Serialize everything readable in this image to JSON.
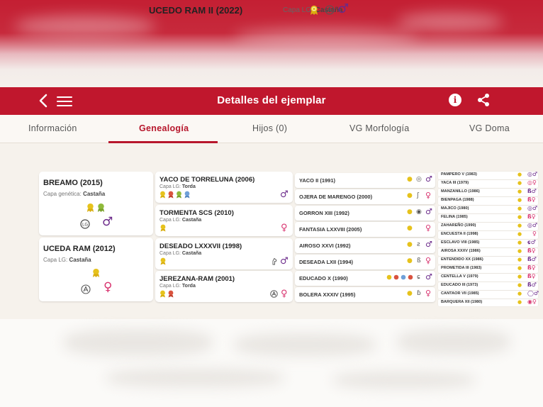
{
  "header": {
    "title": "Detalles del ejemplar",
    "back_icon": "chevron-left-icon",
    "menu_icon": "hamburger-icon",
    "info_icon": "info-icon",
    "share_icon": "share-icon",
    "bar_color": "#c0172d"
  },
  "tabs": [
    {
      "label": "Información"
    },
    {
      "label": "Genealogía",
      "active": true
    },
    {
      "label": "Hijos (0)"
    },
    {
      "label": "VG Morfología"
    },
    {
      "label": "VG Doma"
    }
  ],
  "subject": {
    "name": "UCEDO RAM II (2022)",
    "capa_label": "Capa LG:",
    "capa_value": "Castaña"
  },
  "parents": [
    {
      "name": "BREAMO (2015)",
      "capa_label": "Capa genética:",
      "capa_value": "Castaña",
      "sex": "male"
    },
    {
      "name": "UCEDA RAM (2012)",
      "capa_label": "Capa LG:",
      "capa_value": "Castaña",
      "sex": "female"
    }
  ],
  "grandparents": [
    {
      "name": "YACO DE TORRELUNA (2006)",
      "capa_label": "Capa LG:",
      "capa_value": "Torda",
      "sex": "male"
    },
    {
      "name": "TORMENTA SCS (2010)",
      "capa_label": "Capa LG:",
      "capa_value": "Castaña",
      "sex": "female"
    },
    {
      "name": "DESEADO LXXXVII (1998)",
      "capa_label": "Capa LG:",
      "capa_value": "Castaña",
      "sex": "male"
    },
    {
      "name": "JEREZANA-RAM (2001)",
      "capa_label": "Capa LG:",
      "capa_value": "Torda",
      "sex": "female"
    }
  ],
  "great_grandparents": [
    {
      "name": "YACO II (1991)",
      "sex": "male"
    },
    {
      "name": "OJERA DE MARENGO (2000)",
      "sex": "female"
    },
    {
      "name": "GORRON XIII (1992)",
      "sex": "male"
    },
    {
      "name": "FANTASIA LXXVIII (2005)",
      "sex": "female"
    },
    {
      "name": "AIROSO XXVI (1992)",
      "sex": "male"
    },
    {
      "name": "DESEADA LXII (1994)",
      "sex": "female"
    },
    {
      "name": "EDUCADO X (1990)",
      "sex": "male"
    },
    {
      "name": "BOLERA XXXIV (1995)",
      "sex": "female"
    }
  ],
  "great_great_grandparents": [
    {
      "name": "PAMPERO V (1983)",
      "sex": "male"
    },
    {
      "name": "YACA III (1979)",
      "sex": "female"
    },
    {
      "name": "MANZANILLO (1986)",
      "sex": "male"
    },
    {
      "name": "BIENPAGA (1988)",
      "sex": "female"
    },
    {
      "name": "MAJICO (1980)",
      "sex": "male"
    },
    {
      "name": "FELINA (1985)",
      "sex": "female"
    },
    {
      "name": "ZAHAREÑO (1990)",
      "sex": "male"
    },
    {
      "name": "ENCUESTA II (1998)",
      "sex": "female"
    },
    {
      "name": "ESCLAVO VIII (1985)",
      "sex": "male"
    },
    {
      "name": "AIROSA XXXV (1986)",
      "sex": "female"
    },
    {
      "name": "ENTENDIDO XX (1986)",
      "sex": "male"
    },
    {
      "name": "PROMETIDA III (1983)",
      "sex": "female"
    },
    {
      "name": "CENTELLA V (1979)",
      "sex": "female"
    },
    {
      "name": "EDUCADO III (1973)",
      "sex": "male"
    },
    {
      "name": "CANTAOR VII (1985)",
      "sex": "male"
    },
    {
      "name": "BARQUERA XII (1980)",
      "sex": "female"
    }
  ],
  "colors": {
    "male": "#6b2a8a",
    "female": "#d8326e",
    "medal_gold": "#e6c21c",
    "medal_red": "#d9533f",
    "medal_green": "#8fba3a",
    "medal_blue": "#6fa0d8"
  }
}
